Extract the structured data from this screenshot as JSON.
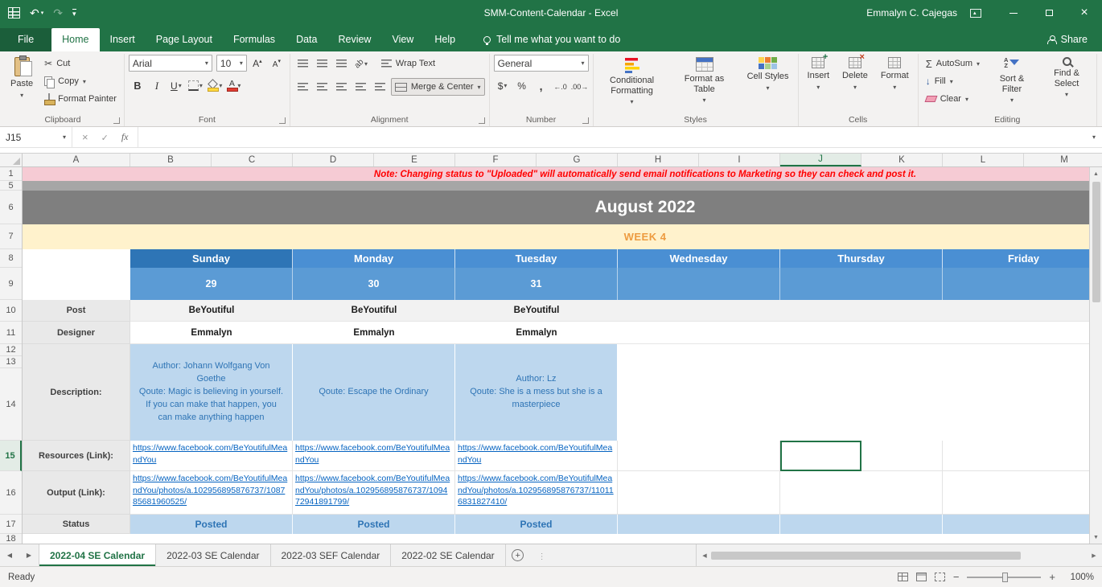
{
  "titlebar": {
    "title": "SMM-Content-Calendar - Excel",
    "user": "Emmalyn C. Cajegas"
  },
  "tabs": {
    "file": "File",
    "items": [
      "Home",
      "Insert",
      "Page Layout",
      "Formulas",
      "Data",
      "Review",
      "View",
      "Help"
    ],
    "tell_me": "Tell me what you want to do",
    "share": "Share"
  },
  "ribbon": {
    "clipboard": {
      "label": "Clipboard",
      "paste": "Paste",
      "cut": "Cut",
      "copy": "Copy",
      "painter": "Format Painter"
    },
    "font": {
      "label": "Font",
      "family": "Arial",
      "size": "10"
    },
    "alignment": {
      "label": "Alignment",
      "wrap": "Wrap Text",
      "merge": "Merge & Center"
    },
    "number": {
      "label": "Number",
      "format": "General"
    },
    "styles": {
      "label": "Styles",
      "conditional": "Conditional Formatting",
      "table": "Format as Table",
      "cell": "Cell Styles"
    },
    "cells": {
      "label": "Cells",
      "insert": "Insert",
      "delete": "Delete",
      "format": "Format"
    },
    "editing": {
      "label": "Editing",
      "autosum": "AutoSum",
      "fill": "Fill",
      "clear": "Clear",
      "sort": "Sort & Filter",
      "find": "Find & Select"
    }
  },
  "formula": {
    "name_box": "J15",
    "value": ""
  },
  "grid": {
    "cols": [
      "A",
      "B",
      "C",
      "D",
      "E",
      "F",
      "G",
      "H",
      "I",
      "J",
      "K",
      "L",
      "M"
    ],
    "rownums": [
      "1",
      "5",
      "6",
      "7",
      "8",
      "9",
      "10",
      "11",
      "12",
      "13",
      "14",
      "15",
      "16",
      "17",
      "18"
    ],
    "note": "Note: Changing status to \"Uploaded\" will automatically send email notifications to Marketing so they can check and post it.",
    "month": "August 2022",
    "week": "WEEK 4",
    "days": [
      "Sunday",
      "Monday",
      "Tuesday",
      "Wednesday",
      "Thursday",
      "Friday"
    ],
    "dates": [
      "29",
      "30",
      "31"
    ],
    "labels": {
      "post": "Post",
      "designer": "Designer",
      "description": "Description:",
      "resources": "Resources (Link):",
      "output": "Output (Link):",
      "status": "Status"
    },
    "post": [
      "BeYoutiful",
      "BeYoutiful",
      "BeYoutiful"
    ],
    "designer": [
      "Emmalyn",
      "Emmalyn",
      "Emmalyn"
    ],
    "description": [
      "Author: Johann Wolfgang Von Goethe\nQoute: Magic is believing in yourself. If you can make that happen, you can make anything happen",
      "Qoute: Escape the Ordinary",
      "Author: Lz\nQoute: She is a mess but she is a masterpiece"
    ],
    "resources": [
      "https://www.facebook.com/BeYoutifulMeandYou",
      "https://www.facebook.com/BeYoutifulMeandYou",
      "https://www.facebook.com/BeYoutifulMeandYou"
    ],
    "output": [
      "https://www.facebook.com/BeYoutifulMeandYou/photos/a.102956895876737/108785681960525/",
      "https://www.facebook.com/BeYoutifulMeandYou/photos/a.102956895876737/109472941891799/",
      "https://www.facebook.com/BeYoutifulMeandYou/photos/a.102956895876737/110116831827410/"
    ],
    "status": [
      "Posted",
      "Posted",
      "Posted"
    ]
  },
  "sheets": {
    "active": "2022-04 SE Calendar",
    "others": [
      "2022-03 SE Calendar",
      "2022-03 SEF Calendar",
      "2022-02 SE Calendar"
    ]
  },
  "statusbar": {
    "mode": "Ready",
    "zoom": "100%"
  },
  "colors": {
    "brand_green": "#217346",
    "header_blue": "#5b9bd5",
    "sunday_blue": "#2e75b6",
    "description_blue": "#bdd7ee",
    "week_orange": "#ed9b40",
    "note_pink": "#f6cbd4",
    "note_red": "#ff0000",
    "link_blue": "#0563c1",
    "month_gray": "#7f7f7f"
  },
  "icons": {
    "undo": "↶",
    "redo": "↷",
    "caret": "▾",
    "autosum": "Σ",
    "close": "×",
    "check": "✓",
    "scissors": "✂"
  }
}
